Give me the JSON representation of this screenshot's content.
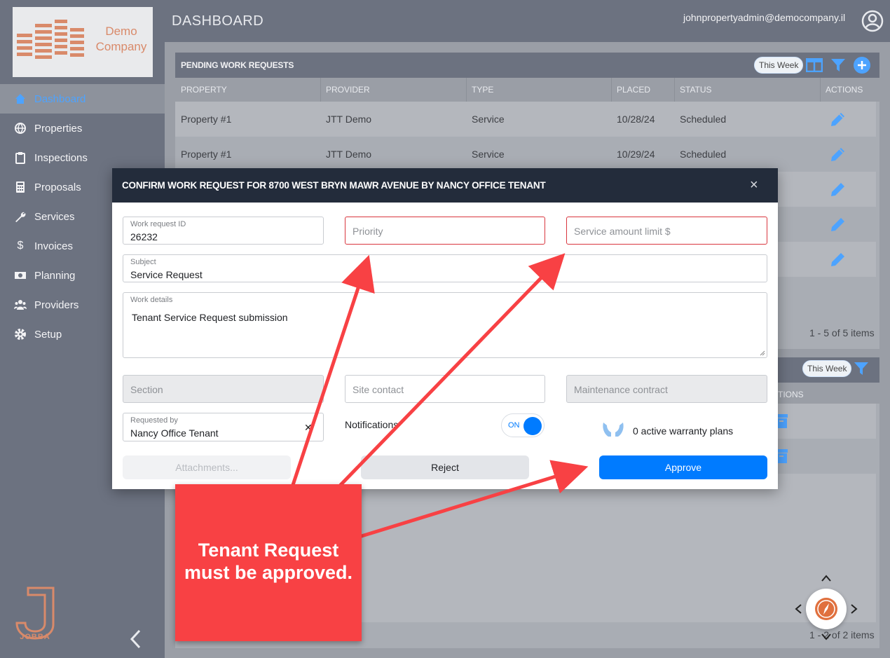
{
  "app": {
    "brand_line1": "Demo",
    "brand_line2": "Company",
    "footer_brand": "JOBBA"
  },
  "header": {
    "title": "DASHBOARD",
    "user_email": "johnpropertyadmin@democompany.il"
  },
  "sidebar": {
    "items": [
      {
        "label": "Dashboard",
        "icon": "home-icon",
        "active": true
      },
      {
        "label": "Properties",
        "icon": "globe-icon"
      },
      {
        "label": "Inspections",
        "icon": "clipboard-icon"
      },
      {
        "label": "Proposals",
        "icon": "calculator-icon"
      },
      {
        "label": "Services",
        "icon": "wrench-icon"
      },
      {
        "label": "Invoices",
        "icon": "dollar-icon"
      },
      {
        "label": "Planning",
        "icon": "money-icon"
      },
      {
        "label": "Providers",
        "icon": "users-icon"
      },
      {
        "label": "Setup",
        "icon": "gear-icon"
      }
    ]
  },
  "pending": {
    "title": "PENDING WORK REQUESTS",
    "chip": "This Week",
    "columns": [
      "PROPERTY",
      "PROVIDER",
      "TYPE",
      "PLACED",
      "STATUS",
      "ACTIONS"
    ],
    "rows": [
      [
        "Property #1",
        "JTT Demo",
        "Service",
        "10/28/24",
        "Scheduled"
      ],
      [
        "Property #1",
        "JTT Demo",
        "Service",
        "10/29/24",
        "Scheduled"
      ]
    ],
    "pager": "1 - 5 of 5 items"
  },
  "second": {
    "chip": "This Week",
    "col_fragment": "TIONS",
    "pager": "1 - 2 of 2 items"
  },
  "modal": {
    "title": "CONFIRM WORK REQUEST FOR 8700 WEST BRYN MAWR AVENUE BY NANCY OFFICE TENANT",
    "close": "×",
    "work_request_id_label": "Work request ID",
    "work_request_id": "26232",
    "priority_placeholder": "Priority",
    "service_limit_placeholder": "Service amount limit $",
    "subject_label": "Subject",
    "subject": "Service Request",
    "details_label": "Work details",
    "details": "Tenant Service Request submission",
    "section_placeholder": "Section",
    "site_contact_placeholder": "Site contact",
    "maintenance_placeholder": "Maintenance contract",
    "requested_by_label": "Requested by",
    "requested_by": "Nancy Office Tenant",
    "notifications_label": "Notifications",
    "toggle_label": "ON",
    "warranty_text": "0 active warranty plans",
    "attachments_label": "Attachments...",
    "reject_label": "Reject",
    "approve_label": "Approve"
  },
  "annotation": {
    "line1": "Tenant Request",
    "line2": "must be approved."
  },
  "colors": {
    "accent": "#007bff",
    "sidebar": "#6c7280",
    "modal_header": "#232c3b",
    "callout": "#f84144",
    "error": "#d9363e"
  }
}
